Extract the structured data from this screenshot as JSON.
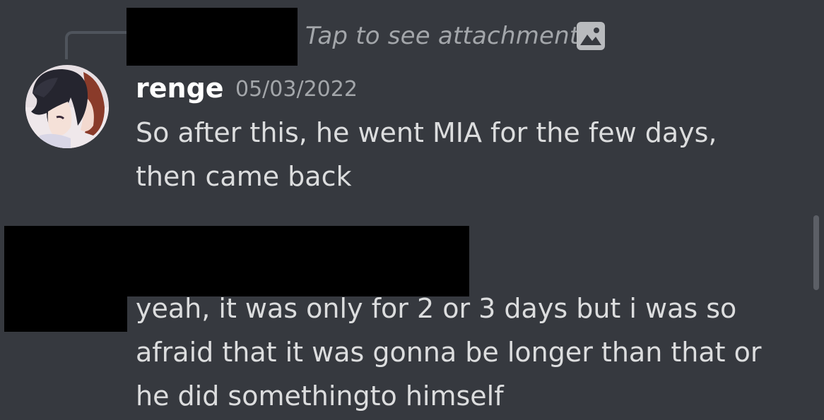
{
  "reply": {
    "preview_text": "Tap to see attachment",
    "attachment_icon": "image-icon"
  },
  "message1": {
    "username": "renge",
    "timestamp": "05/03/2022",
    "lines": [
      "So after this, he went MIA for the few days,",
      "then came back"
    ]
  },
  "message2": {
    "lines": [
      "yeah, it was only for 2 or 3 days but i was so",
      "afraid that it was gonna be longer than that or",
      "he did somethingto himself"
    ]
  },
  "colors": {
    "background": "#36393f",
    "username": "#ffffff",
    "message_text": "#dcddde",
    "muted_text": "#a3a6aa",
    "redaction": "#000000"
  }
}
